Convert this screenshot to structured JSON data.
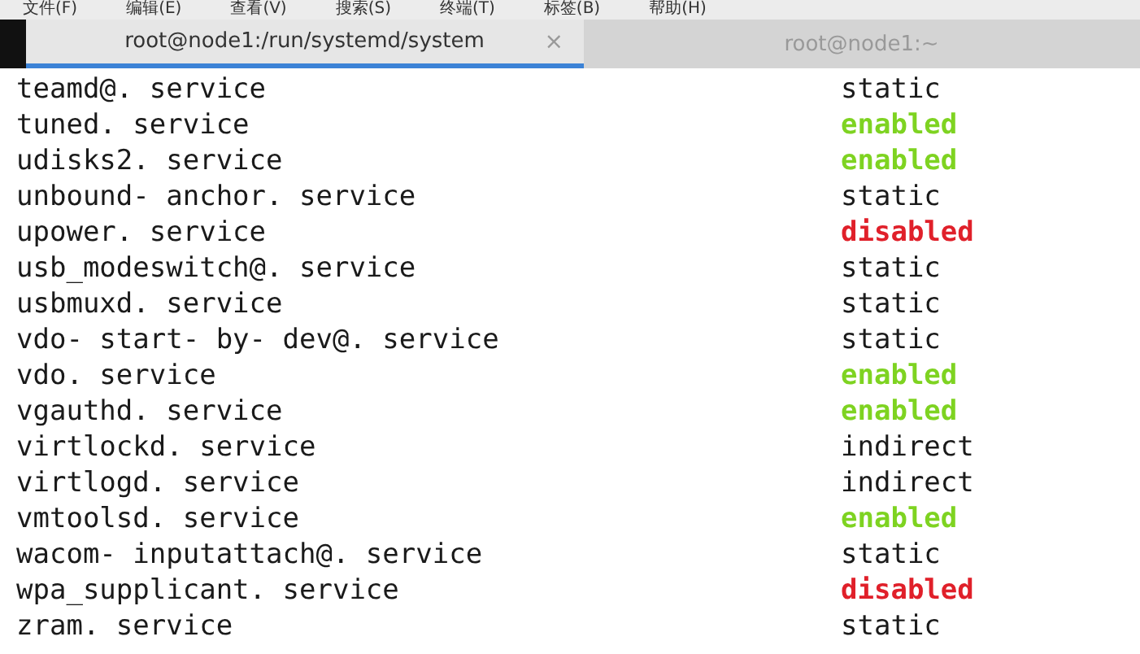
{
  "menu_bar": [
    "文件(F)",
    "编辑(E)",
    "查看(V)",
    "搜索(S)",
    "终端(T)",
    "标签(B)",
    "帮助(H)"
  ],
  "tabs": [
    {
      "title": "root@node1:/run/systemd/system",
      "close": "×",
      "selected": true
    },
    {
      "title": "root@node1:~",
      "selected": false
    }
  ],
  "rows": [
    {
      "unit": "teamd@. service",
      "state": "static",
      "kind": "plain",
      "color": "#1a1a1a"
    },
    {
      "unit": "tuned. service",
      "state": "enabled",
      "kind": "bold",
      "color": "#7ed321"
    },
    {
      "unit": "udisks2. service",
      "state": "enabled",
      "kind": "bold",
      "color": "#7ed321"
    },
    {
      "unit": "unbound- anchor. service",
      "state": "static",
      "kind": "plain",
      "color": "#1a1a1a"
    },
    {
      "unit": "upower. service",
      "state": "disabled",
      "kind": "bold",
      "color": "#e0202a"
    },
    {
      "unit": "usb_modeswitch@. service",
      "state": "static",
      "kind": "plain",
      "color": "#1a1a1a"
    },
    {
      "unit": "usbmuxd. service",
      "state": "static",
      "kind": "plain",
      "color": "#1a1a1a"
    },
    {
      "unit": "vdo- start- by- dev@. service",
      "state": "static",
      "kind": "plain",
      "color": "#1a1a1a"
    },
    {
      "unit": "vdo. service",
      "state": "enabled",
      "kind": "bold",
      "color": "#7ed321"
    },
    {
      "unit": "vgauthd. service",
      "state": "enabled",
      "kind": "bold",
      "color": "#7ed321"
    },
    {
      "unit": "virtlockd. service",
      "state": "indirect",
      "kind": "plain",
      "color": "#1a1a1a"
    },
    {
      "unit": "virtlogd. service",
      "state": "indirect",
      "kind": "plain",
      "color": "#1a1a1a"
    },
    {
      "unit": "vmtoolsd. service",
      "state": "enabled",
      "kind": "bold",
      "color": "#7ed321"
    },
    {
      "unit": "wacom- inputattach@. service",
      "state": "static",
      "kind": "plain",
      "color": "#1a1a1a"
    },
    {
      "unit": "wpa_supplicant. service",
      "state": "disabled",
      "kind": "bold",
      "color": "#e0202a"
    },
    {
      "unit": "zram. service",
      "state": "static",
      "kind": "plain",
      "color": "#1a1a1a"
    }
  ]
}
